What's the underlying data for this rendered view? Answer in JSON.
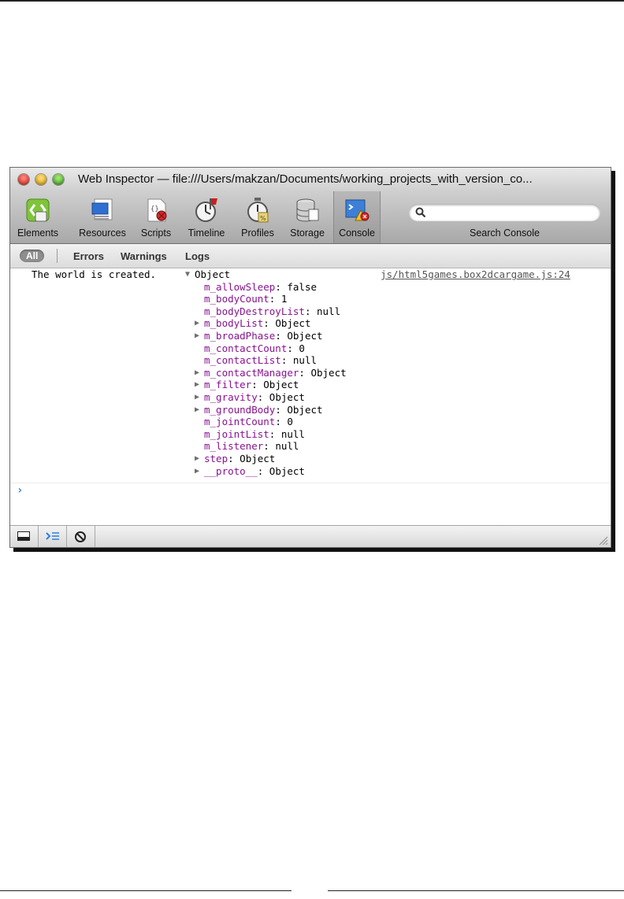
{
  "window": {
    "title": "Web Inspector — file:///Users/makzan/Documents/working_projects_with_version_co..."
  },
  "toolbar": {
    "tabs": [
      {
        "label": "Elements",
        "icon": "elements-icon"
      },
      {
        "label": "Resources",
        "icon": "resources-icon"
      },
      {
        "label": "Scripts",
        "icon": "scripts-icon"
      },
      {
        "label": "Timeline",
        "icon": "timeline-icon"
      },
      {
        "label": "Profiles",
        "icon": "profiles-icon"
      },
      {
        "label": "Storage",
        "icon": "storage-icon"
      },
      {
        "label": "Console",
        "icon": "console-icon",
        "active": true
      }
    ],
    "search_label": "Search Console",
    "search_value": ""
  },
  "filters": {
    "all": "All",
    "errors": "Errors",
    "warnings": "Warnings",
    "logs": "Logs"
  },
  "console": {
    "message": "The world is created.",
    "source": "js/html5games.box2dcargame.js:24",
    "object_label": "Object",
    "properties": [
      {
        "key": "m_allowSleep",
        "value": "false",
        "expandable": false
      },
      {
        "key": "m_bodyCount",
        "value": "1",
        "expandable": false
      },
      {
        "key": "m_bodyDestroyList",
        "value": "null",
        "expandable": false
      },
      {
        "key": "m_bodyList",
        "value": "Object",
        "expandable": true
      },
      {
        "key": "m_broadPhase",
        "value": "Object",
        "expandable": true
      },
      {
        "key": "m_contactCount",
        "value": "0",
        "expandable": false
      },
      {
        "key": "m_contactList",
        "value": "null",
        "expandable": false
      },
      {
        "key": "m_contactManager",
        "value": "Object",
        "expandable": true
      },
      {
        "key": "m_filter",
        "value": "Object",
        "expandable": true
      },
      {
        "key": "m_gravity",
        "value": "Object",
        "expandable": true
      },
      {
        "key": "m_groundBody",
        "value": "Object",
        "expandable": true
      },
      {
        "key": "m_jointCount",
        "value": "0",
        "expandable": false
      },
      {
        "key": "m_jointList",
        "value": "null",
        "expandable": false
      },
      {
        "key": "m_listener",
        "value": "null",
        "expandable": false
      },
      {
        "key": "step",
        "value": "Object",
        "expandable": true
      },
      {
        "key": "__proto__",
        "value": "Object",
        "expandable": true
      }
    ],
    "prompt_symbol": "›",
    "prompt_value": ""
  },
  "colors": {
    "property_key": "#881391",
    "prompt": "#2f7fe0"
  }
}
